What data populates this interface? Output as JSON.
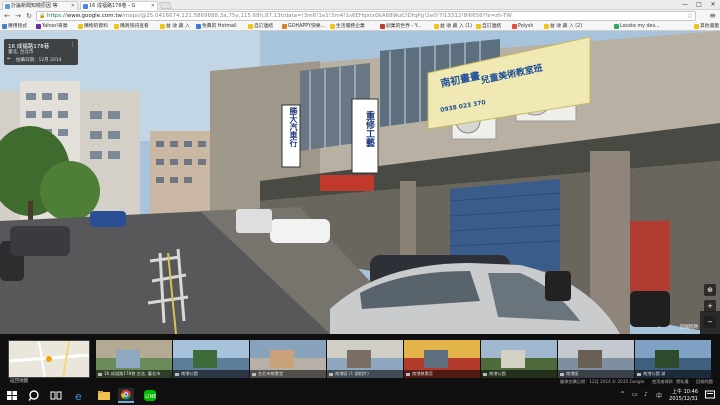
{
  "browser": {
    "tabs": [
      {
        "title": "計論新聞知曉原因 等",
        "fav_color": "#5a9bd5"
      },
      {
        "title": "16 成福路178巷 - G",
        "fav_color": "#4285f4"
      }
    ],
    "window_buttons": [
      "—",
      "□",
      "✕"
    ],
    "url_https": "https://",
    "url_host": "www.google.com.tw",
    "url_rest": "/maps/@25.0416674,121.5869688,3a,75y,115.68h,87.13t/data=!3m6!1e1!3m4!1s6EHqxtx0kA689kzCIDfqPg!2e0!7i13312!8i6656?hl=zh-TW",
    "bookmarks": [
      {
        "label": "應用程式",
        "color": "#4a7bd1"
      },
      {
        "label": "Yahoo!奇摩",
        "color": "#6c2ba8"
      },
      {
        "label": "購物的資料",
        "color": "#f1c40f"
      },
      {
        "label": "購買快訊查看",
        "color": "#f1c40f"
      },
      {
        "label": "益 收 藏 入",
        "color": "#f1c40f"
      },
      {
        "label": "免費的 Hotmail",
        "color": "#3a7bd5"
      },
      {
        "label": "自訂連結",
        "color": "#f1c40f"
      },
      {
        "label": "GOHAPPY快樂...",
        "color": "#e67e22"
      },
      {
        "label": "生活服務企業",
        "color": "#f1c40f"
      },
      {
        "label": "創業的世界 - Y...",
        "color": "#c0392b"
      },
      {
        "label": "益 收 藏 入 (1)",
        "color": "#f1c40f"
      },
      {
        "label": "自訂連結",
        "color": "#f1c40f"
      },
      {
        "label": "Polysh",
        "color": "#e74c3c"
      },
      {
        "label": "益 收 藏 入 (2)",
        "color": "#f1c40f"
      },
      {
        "label": "Locate my dev...",
        "color": "#27ae60"
      },
      {
        "label": "其他書籤",
        "color": "#f1c40f"
      }
    ]
  },
  "streetview": {
    "place_title": "16 成福路178巷",
    "place_sub": "臺北, 台北市",
    "capture_date": "拍攝日期：12月 2014",
    "report": "回報問題",
    "signs": {
      "shop1": "勝大汽車行",
      "shop2": "重修工藝",
      "banner_title": "南初畫畫",
      "banner_sub": "兒童美術教室班",
      "banner_phone": "0938 023 370"
    }
  },
  "filmstrip": {
    "minimap_label": "返回地圖",
    "thumbs": [
      {
        "caption": "16 成福路178巷 台北, 臺北市"
      },
      {
        "caption": "南港公園"
      },
      {
        "caption": "台北市慈惠堂"
      },
      {
        "caption": "南港區 (1 個相片)"
      },
      {
        "caption": "南港慈惠宮"
      },
      {
        "caption": "南港公園"
      },
      {
        "caption": "南港區"
      },
      {
        "caption": "南港公園 湖"
      }
    ],
    "footer_date": "圖像拍攝日期：12月 2014",
    "footer_copyright": "© 2015 Google",
    "footer_terms": "使用者條款",
    "footer_privacy": "隱私權",
    "footer_report": "回報問題"
  },
  "taskbar": {
    "time": "上午 10:46",
    "date": "2015/12/31"
  }
}
